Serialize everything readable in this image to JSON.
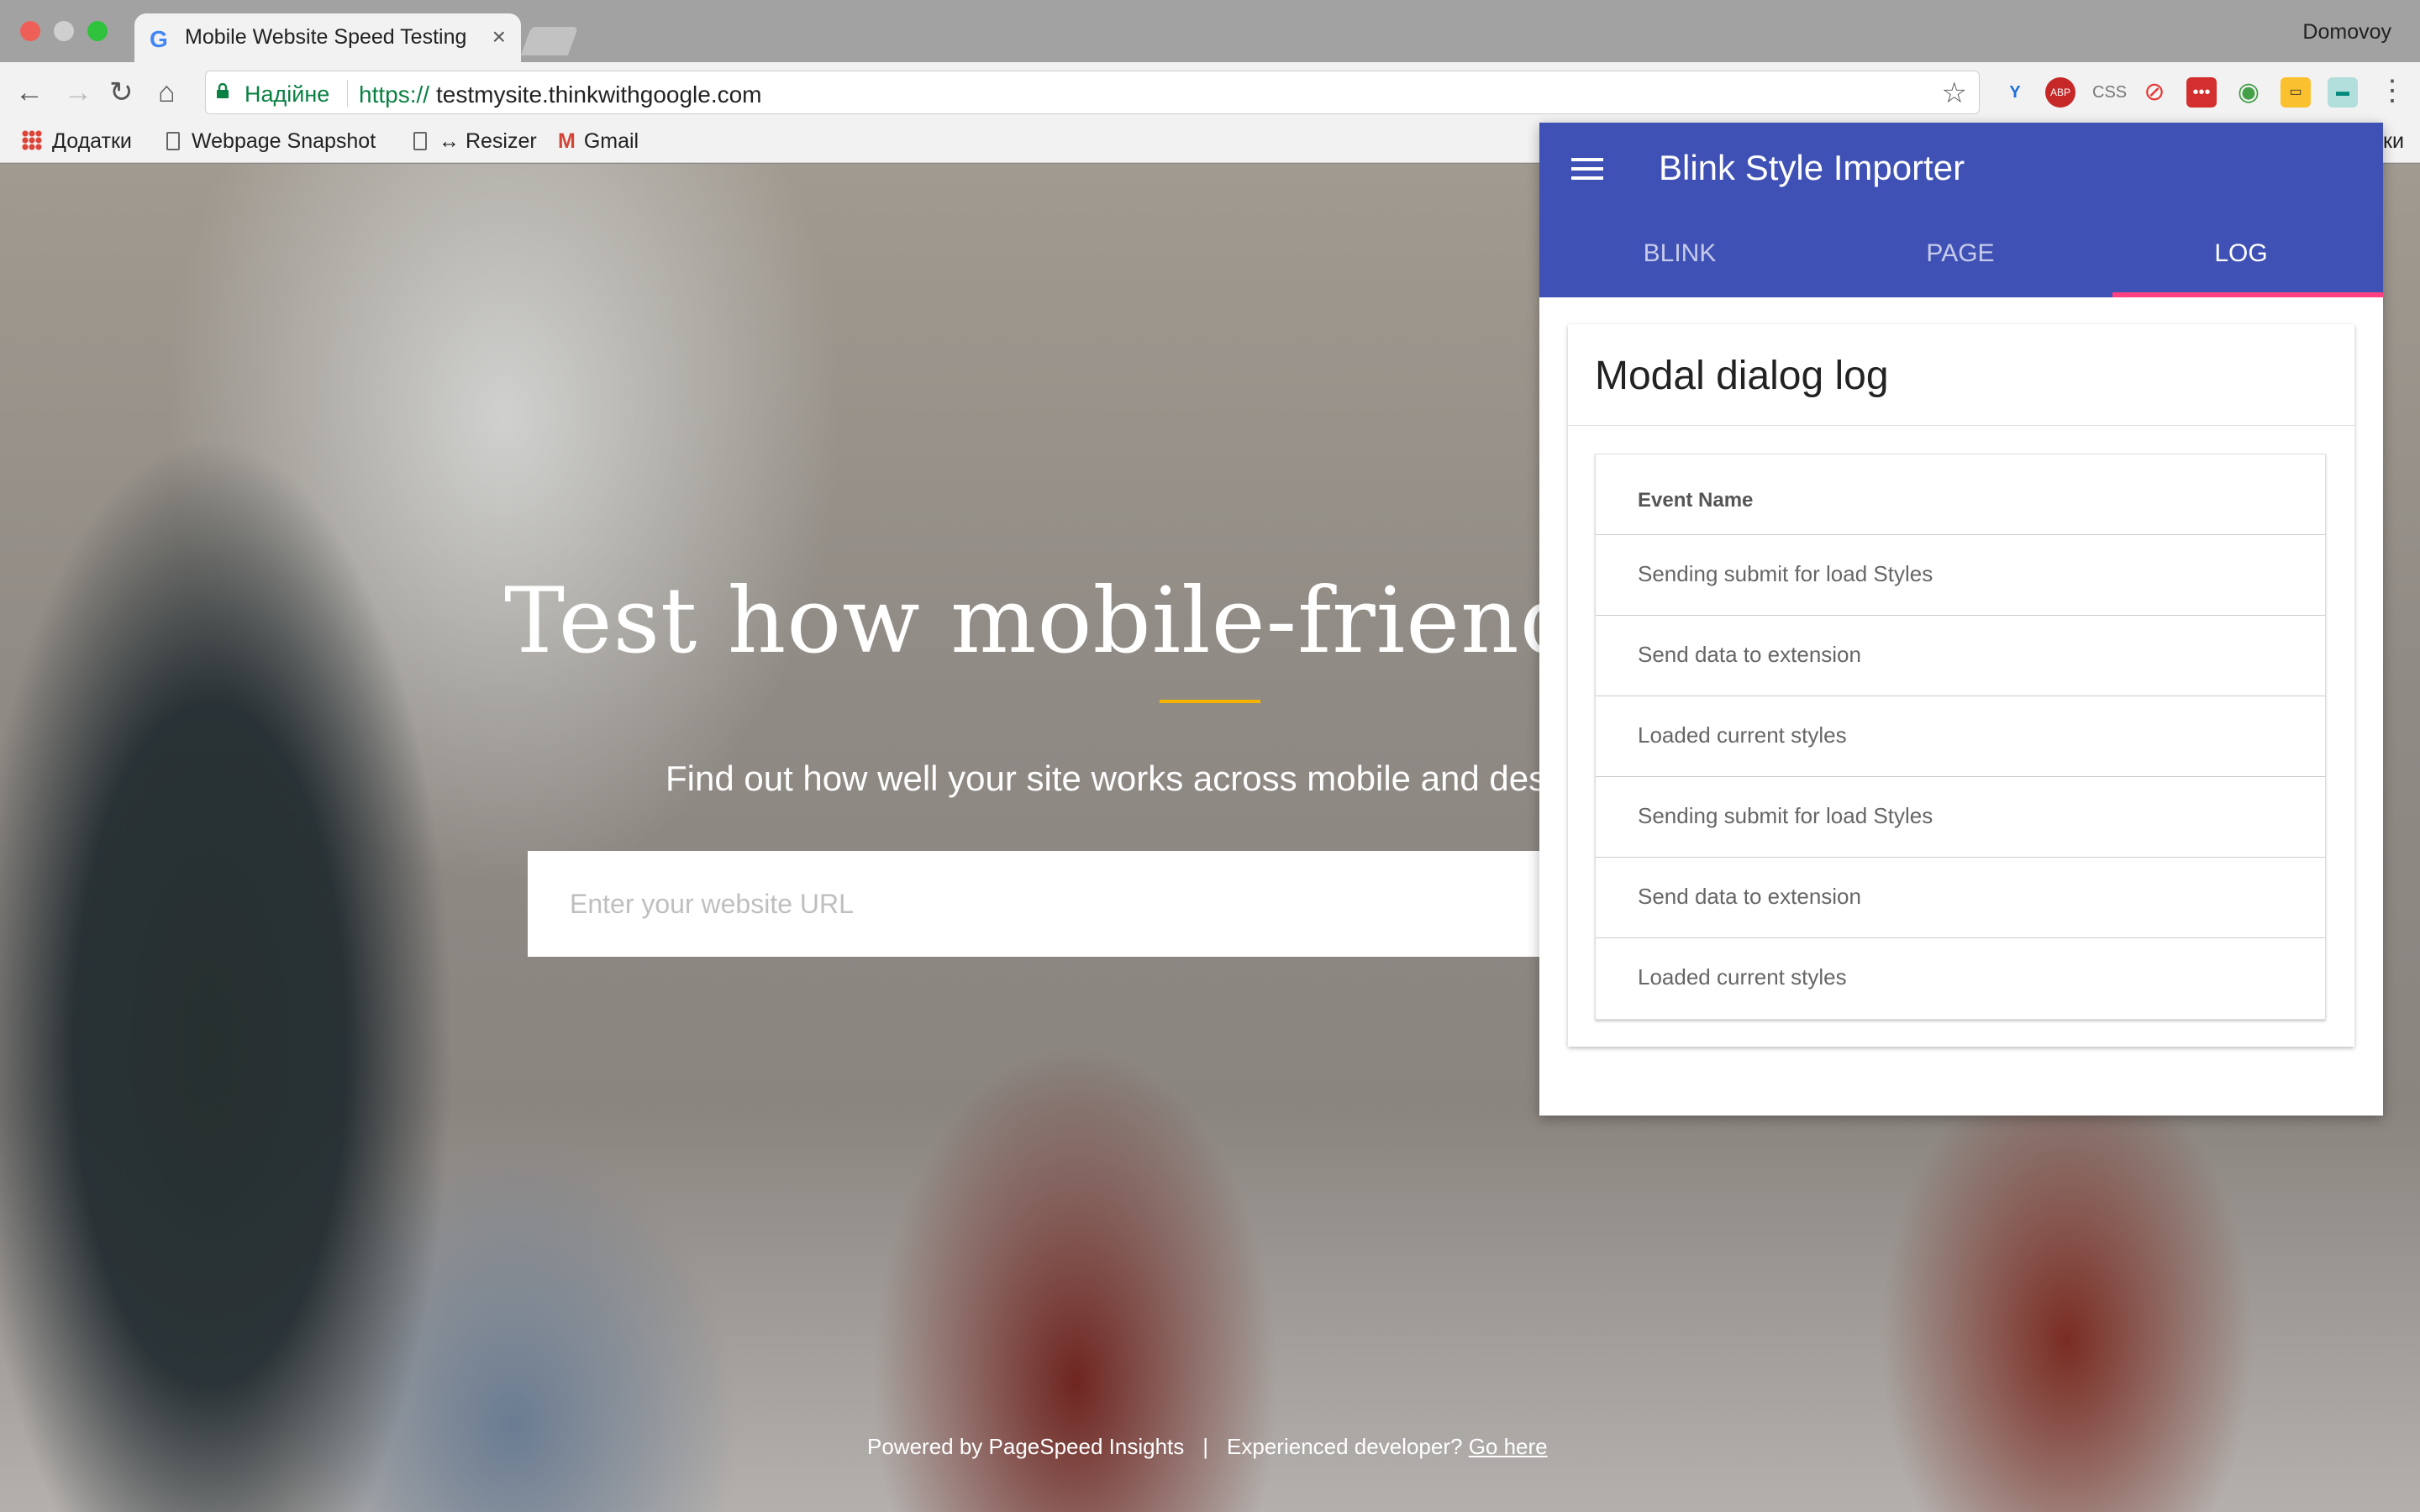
{
  "browser": {
    "tab_title": "Mobile Website Speed Testing Tool",
    "tab_favicon": "G",
    "profile_name": "Domovoy",
    "secure_label": "Надійне",
    "url_scheme": "https://",
    "url_host": "testmysite.thinkwithgoogle.com",
    "bookmarks": [
      "Додатки",
      "Webpage Snapshot",
      "↔ Resizer",
      "Gmail"
    ],
    "bookmarks_overflow": "ки",
    "extension_labels": {
      "css": "CSS"
    }
  },
  "page": {
    "hero_title": "Test how mobile-friendly your site is",
    "hero_subtitle": "Find out how well your site works across mobile and desktop",
    "url_placeholder": "Enter your website URL",
    "footer_powered": "Powered by PageSpeed Insights",
    "footer_separator": "|",
    "footer_question": "Experienced developer?",
    "footer_link": "Go here"
  },
  "popup": {
    "title": "Blink Style Importer",
    "tabs": [
      "BLINK",
      "PAGE",
      "LOG"
    ],
    "active_tab": "LOG",
    "card_title": "Modal dialog log",
    "column_header": "Event Name",
    "rows": [
      "Sending submit for load Styles",
      "Send data to extension",
      "Loaded current styles",
      "Sending submit for load Styles",
      "Send data to extension",
      "Loaded current styles"
    ]
  },
  "colors": {
    "popup_primary": "#3f51b5",
    "tab_indicator": "#ff4081",
    "hero_accent": "#f4b400",
    "secure_green": "#0b8043"
  }
}
